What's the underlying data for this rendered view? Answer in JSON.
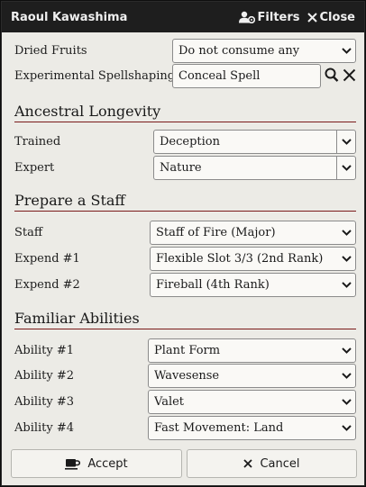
{
  "window": {
    "title": "Raoul Kawashima",
    "filters_label": "Filters",
    "close_label": "Close"
  },
  "top_rows": {
    "dried_fruits": {
      "label": "Dried Fruits",
      "value": "Do not consume any"
    },
    "spellshaping": {
      "label": "Experimental Spellshaping",
      "value": "Conceal Spell"
    }
  },
  "ancestral_longevity": {
    "heading": "Ancestral Longevity",
    "rows": [
      {
        "label": "Trained",
        "value": "Deception"
      },
      {
        "label": "Expert",
        "value": "Nature"
      }
    ]
  },
  "prepare_staff": {
    "heading": "Prepare a Staff",
    "rows": [
      {
        "label": "Staff",
        "value": "Staff of Fire (Major)"
      },
      {
        "label": "Expend #1",
        "value": "Flexible Slot 3/3 (2nd Rank)"
      },
      {
        "label": "Expend #2",
        "value": "Fireball (4th Rank)"
      }
    ]
  },
  "familiar_abilities": {
    "heading": "Familiar Abilities",
    "rows": [
      {
        "label": "Ability #1",
        "value": "Plant Form"
      },
      {
        "label": "Ability #2",
        "value": "Wavesense"
      },
      {
        "label": "Ability #3",
        "value": "Valet"
      },
      {
        "label": "Ability #4",
        "value": "Fast Movement: Land"
      }
    ]
  },
  "footer": {
    "accept_label": "Accept",
    "cancel_label": "Cancel"
  },
  "icons": {
    "filters": "user-gear-icon",
    "close": "close-icon",
    "search": "search-icon",
    "clear": "clear-icon",
    "accept": "mug-icon",
    "cancel": "close-icon",
    "dropdown": "chevron-down-icon"
  },
  "colors": {
    "titlebar": "#1e1e1e",
    "body": "#ecebe6",
    "section_rule": "#7a1a1a"
  }
}
